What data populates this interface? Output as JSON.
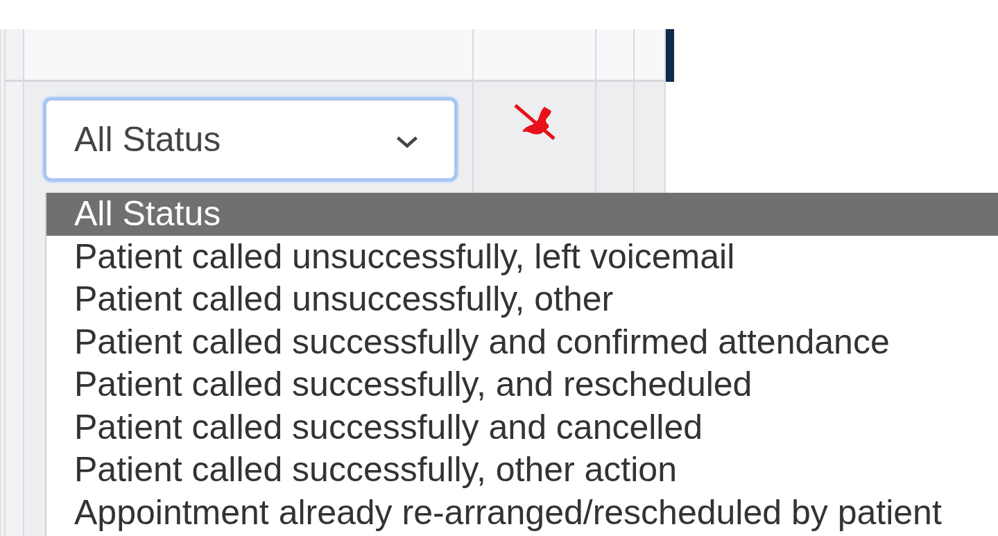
{
  "filter": {
    "value": "All Status",
    "expanded": true
  },
  "dropdown": {
    "options": [
      {
        "label": "All Status",
        "selected": true
      },
      {
        "label": "Patient called unsuccessfully, left voicemail",
        "selected": false
      },
      {
        "label": "Patient called unsuccessfully, other",
        "selected": false
      },
      {
        "label": "Patient called successfully and confirmed attendance",
        "selected": false
      },
      {
        "label": "Patient called successfully, and rescheduled",
        "selected": false
      },
      {
        "label": "Patient called successfully and cancelled",
        "selected": false
      },
      {
        "label": "Patient called successfully, other action",
        "selected": false
      },
      {
        "label": "Appointment already re-arranged/rescheduled by patient",
        "selected": false
      }
    ]
  }
}
